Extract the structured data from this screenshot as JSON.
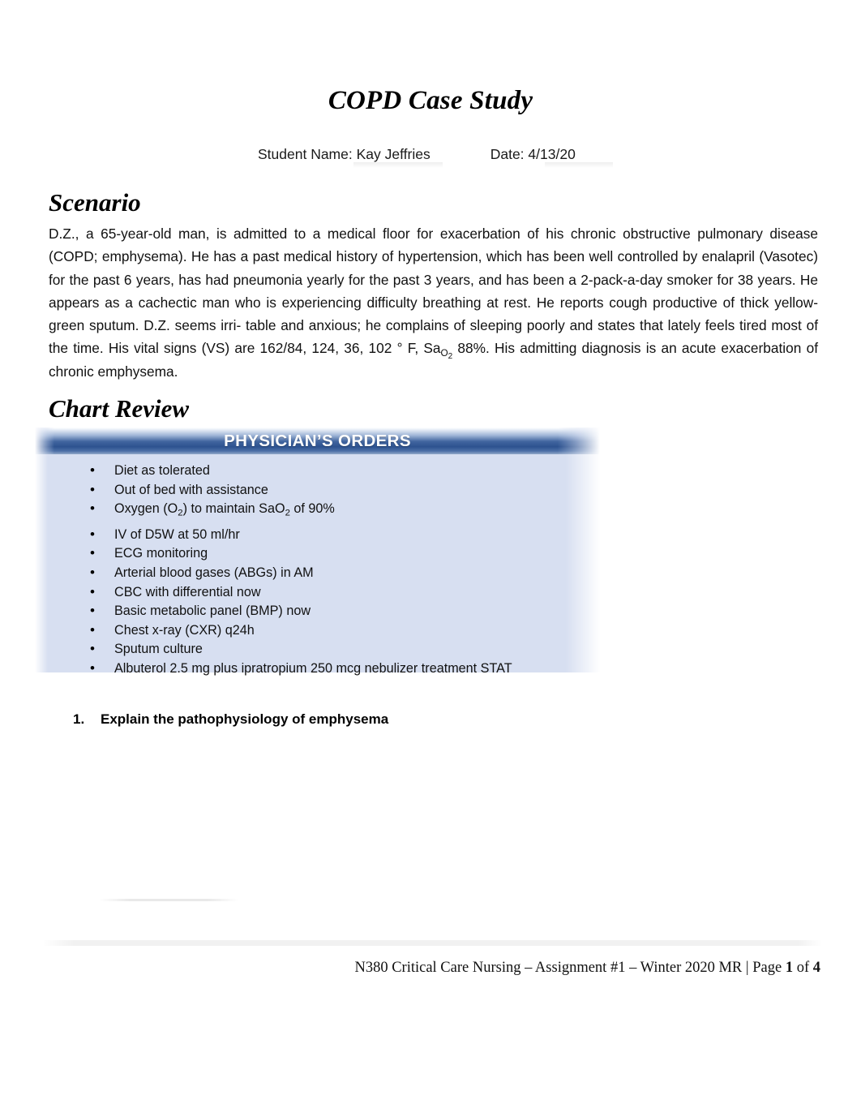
{
  "document": {
    "title": "COPD Case Study",
    "meta": {
      "student_label": "Student Name:",
      "student_name": "Kay Jeffries",
      "date_label": "Date:",
      "date_value": "4/13/20"
    }
  },
  "scenario": {
    "heading": "Scenario",
    "text_part_1": "D.Z., a 65-year-old man, is admitted to a medical floor for exacerbation of his chronic obstructive pulmonary disease (COPD; emphysema). He has a past medical history of hypertension, which has been well controlled by enalapril (Vasotec) for the past 6 years, has had pneumonia yearly for the past 3 years, and has been a 2-pack-a-day smoker for 38 years. He appears as a cachectic man who is experiencing difficulty breathing at rest. He reports cough productive of thick yellow-green sputum. D.Z. seems irri- table and anxious; he complains of sleeping poorly and states that lately feels tired most of the time. His vital signs (VS) are 162/84, 124, 36, 102 ° F, Sa",
    "sao2_subscript": "O2",
    "text_part_2": " 88%. His admitting diagnosis is an acute exacerbation of chronic emphysema."
  },
  "chart_review": {
    "heading": "Chart Review",
    "orders_box": {
      "header_title": "PHYSICIAN’S ORDERS",
      "items": [
        {
          "text": "Diet as tolerated"
        },
        {
          "text": "Out of bed with assistance"
        },
        {
          "text_before": "Oxygen (O",
          "sub_1": "2",
          "text_middle": ") to maintain SaO",
          "sub_2": "2",
          "text_after": " of 90%"
        },
        {
          "text": "IV of D5W at 50 ml/hr"
        },
        {
          "text": "ECG monitoring"
        },
        {
          "text": "Arterial blood gases (ABGs) in AM"
        },
        {
          "text": "CBC with differential now"
        },
        {
          "text": "Basic metabolic panel (BMP) now"
        },
        {
          "text": "Chest x-ray (CXR) q24h"
        },
        {
          "text": "Sputum culture"
        },
        {
          "text": "Albuterol 2.5 mg plus ipratropium 250 mcg nebulizer treatment STAT"
        }
      ]
    }
  },
  "questions": [
    {
      "number": "1.",
      "text": "Explain the pathophysiology of emphysema"
    }
  ],
  "footer": {
    "course_text": "N380 Critical Care Nursing – Assignment #1 – Winter 2020 MR | Page ",
    "page_current": "1",
    "page_of": " of ",
    "page_total": "4"
  },
  "colors": {
    "orders_box_bg": "#d7dff1",
    "orders_header_blue": "#2d528f",
    "text": "#111111"
  }
}
